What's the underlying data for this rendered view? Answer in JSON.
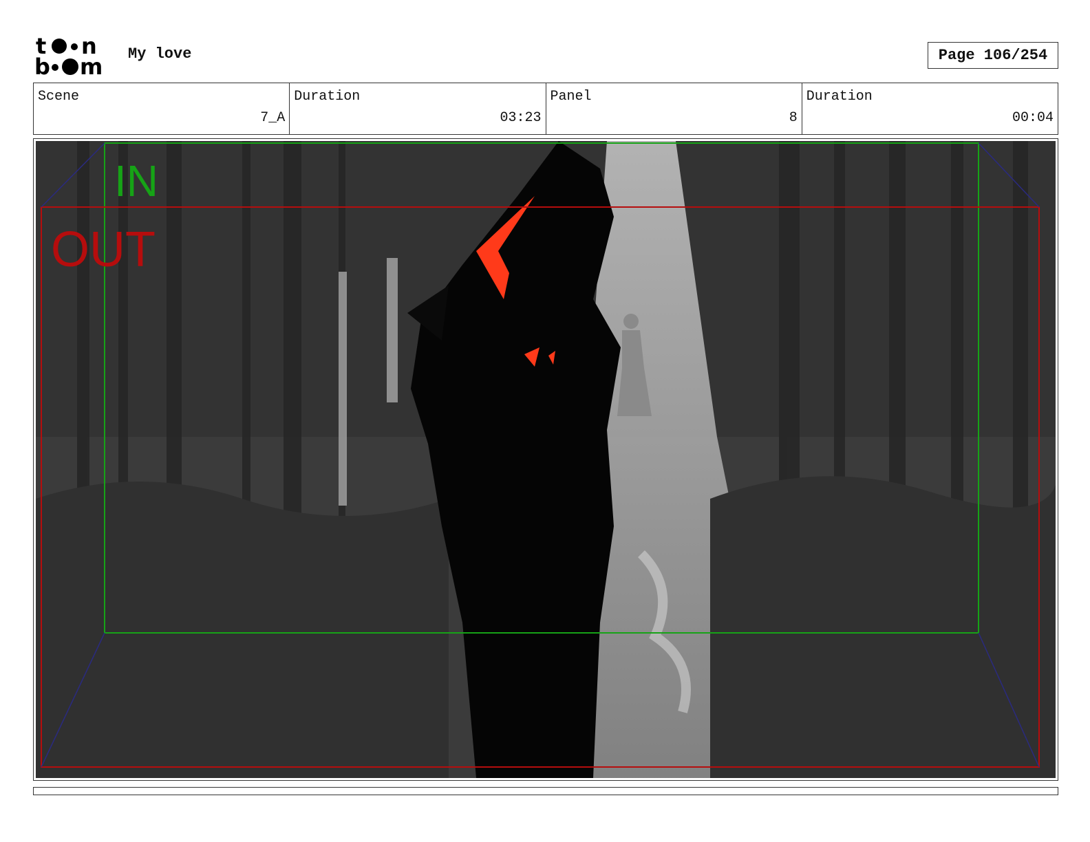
{
  "header": {
    "logo": {
      "text_line1": "toon",
      "text_line2": "boom"
    },
    "project_title": "My love",
    "page_label": "Page 106/254"
  },
  "info_table": [
    {
      "label": "Scene",
      "value": "7_A"
    },
    {
      "label": "Duration",
      "value": "03:23"
    },
    {
      "label": "Panel",
      "value": "8"
    },
    {
      "label": "Duration",
      "value": "00:04"
    }
  ],
  "panel": {
    "in_label": "IN",
    "out_label": "OUT",
    "colors": {
      "in_frame": "#16a316",
      "out_frame": "#b60d0d",
      "accent": "#ff3a1a"
    }
  }
}
